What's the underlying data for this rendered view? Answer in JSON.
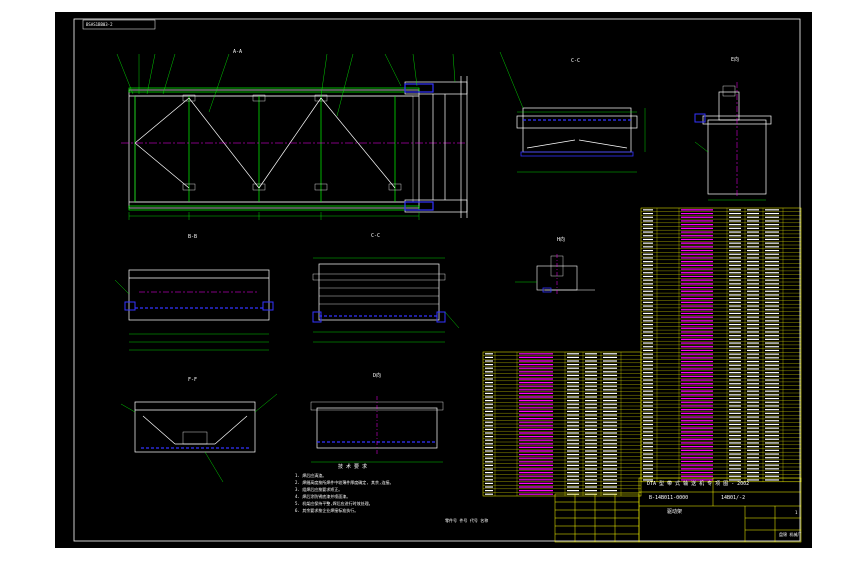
{
  "colors": {
    "background": "#000000",
    "frame": "#ffffff",
    "struct": "#ffffff",
    "green": "#00ff00",
    "blue": "#3333ff",
    "magenta": "#ff00ff",
    "yellow": "#ffff00",
    "cyan": "#00ffff"
  },
  "sheet": {
    "tag": "BSAS1BB03-2",
    "drawing_no": "B-14B011-0000",
    "sheet_code": "14B01/-2",
    "title_line": "DTA 型 带 式 输 送 机 专 项 图 - 2002",
    "part_name": "驱动架",
    "org": "盘锦 机械厂",
    "revision": "1"
  },
  "views": {
    "main": "A-A",
    "right_top": "C-C",
    "far_right": "E向",
    "section_bb": "B-B",
    "section_cc": "C-C",
    "section_ff": "F-F",
    "view_h": "H向",
    "view_d": "D向"
  },
  "notes": {
    "title": "技 术 要 求",
    "lines": [
      "1. 焊后应清渣。",
      "2. 焊缝高度按所焊件中较薄件厚度确定, 其余,连接。",
      "3. 组焊后应按要求矫正。",
      "4. 焊后涂防锈底漆并喷面漆。",
      "5. 机架应保持平整,焊后应进行时效处理。",
      "6. 其余要求按企业焊接标准执行。"
    ],
    "footer": "零件号  件号  代号  名称"
  }
}
